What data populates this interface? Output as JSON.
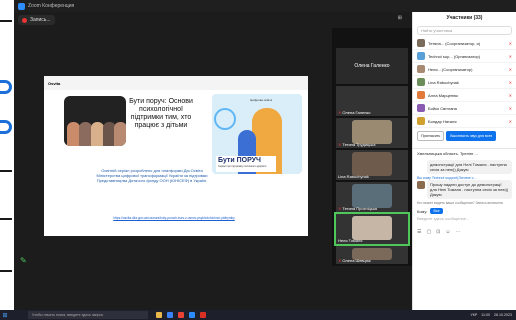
{
  "window": {
    "title": "Zoom Конференция"
  },
  "topbar": {
    "recording_label": "Запись..."
  },
  "share": {
    "slide_header_logo": "Osvita",
    "slide_title": "Бути поруч: Основи психологічної підтримки тим, хто працює з дітьми",
    "caption": "Освітній серіал розроблено для платформи Дія.Освіта Міністерства цифрової трансформації України за підтримки Представництва Дитячого фонду ООН (ЮНІСЕФ) в Україні.",
    "link": "https://osvita.diia.gov.ua/courses/buty-poruch-kurs-z-osnov-psykholohichnoi-pidtrymky",
    "poster_title": "Бути ПОРУЧ",
    "poster_subtitle": "Серіал про підтримку психічного здоров'я",
    "poster_logo": "Цифрова освіта"
  },
  "gallery": {
    "self_name": "Олена Галенко",
    "tiles": [
      {
        "name": "Олена Галенко"
      },
      {
        "name": "Тетяна Трудицька"
      },
      {
        "name": "Lina Rabuchynak"
      },
      {
        "name": "Тетяна Прохніцька"
      },
      {
        "name": "Неля Томаля"
      },
      {
        "name": "Олена Шевцюк"
      }
    ]
  },
  "participants": {
    "header": "Участники (33)",
    "search_placeholder": "Найти участника",
    "list": [
      {
        "name": "Тетяна... (Соорганизатор, я)"
      },
      {
        "name": "Technol sup... (Организатор)"
      },
      {
        "name": "Неля... (Соорганизатор)"
      },
      {
        "name": "Lina Rabuchynak"
      },
      {
        "name": "Алла Марценюк"
      },
      {
        "name": "Бойко Світлана"
      },
      {
        "name": "Бондар Наталя"
      }
    ],
    "invite_label": "Пригласить",
    "mute_all_label": "Выключить звук для всех"
  },
  "chat": {
    "header": "Хмельницька область. Тренінг ...",
    "messages": [
      {
        "sender": "",
        "text": "демонстрації для Нелі Томаля . наступна сесія за нею)) Дякую"
      },
      {
        "sender": "Вы кому Technol support(Личное с...",
        "text": "Прошу надати доступ до демонстрації для Нелі Томаля . наступна сесія за нею)) Дякую"
      }
    ],
    "note": "Кто может видеть ваши сообщения? Запись включена",
    "to_label": "Кому:",
    "to_value": "Все",
    "input_placeholder": "Введите здесь сообщение..."
  },
  "taskbar": {
    "search_placeholder": "Чтобы начать поиск, введите здесь запрос",
    "tray_lang": "УКР",
    "time": "11:00",
    "date": "26.10.2023"
  }
}
